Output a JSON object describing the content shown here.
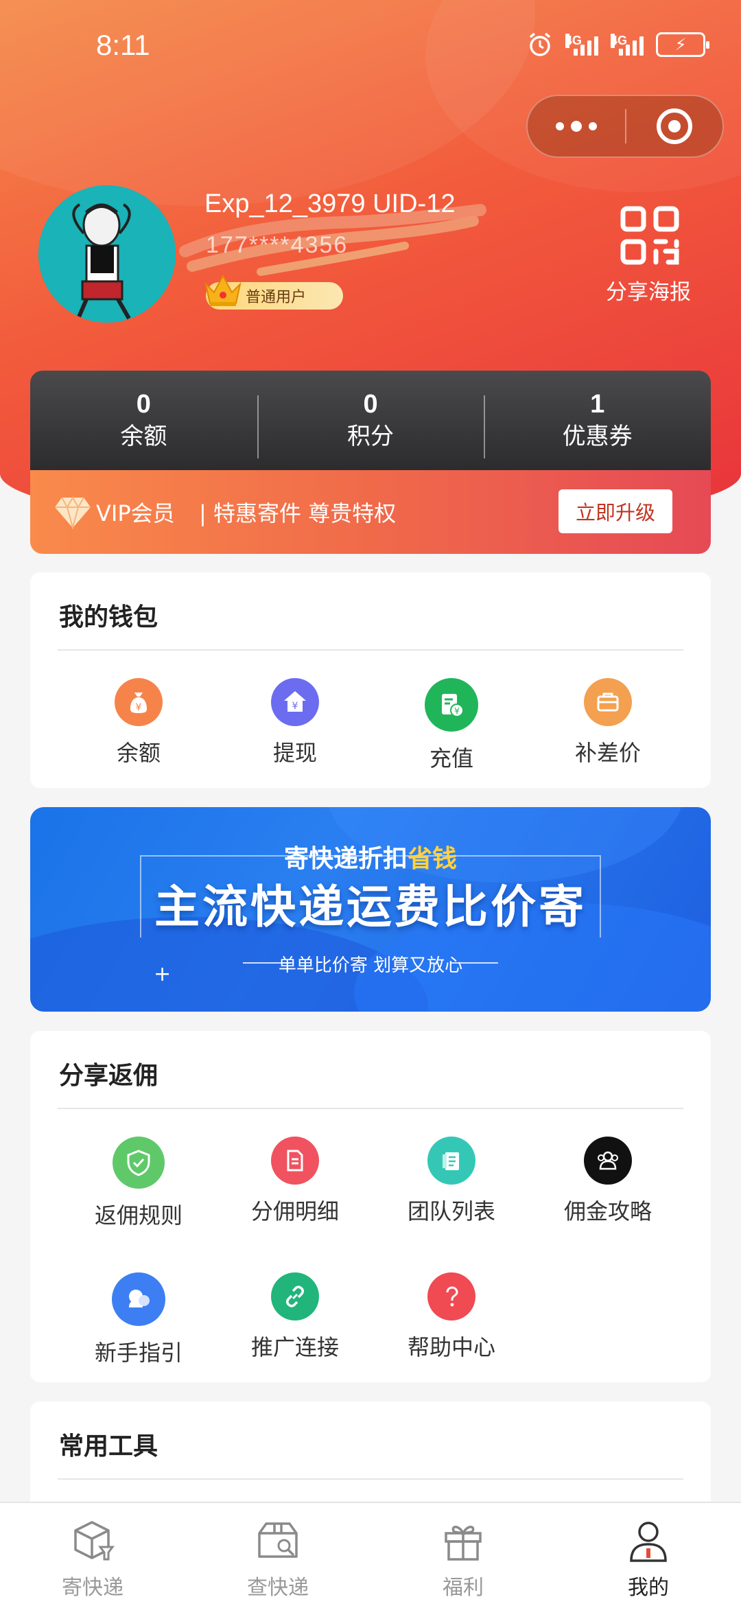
{
  "status_bar": {
    "time": "8:11",
    "network_1": "4G",
    "network_2": "4G"
  },
  "capsule": {
    "more_icon": "more-dots-icon",
    "close_icon": "target-close-icon"
  },
  "profile": {
    "username": "Exp_12_3979 UID-12",
    "phone_masked": "177****4356",
    "member_badge": "普通用户",
    "share_poster_label": "分享海报"
  },
  "stats": [
    {
      "value": "0",
      "label": "余额"
    },
    {
      "value": "0",
      "label": "积分"
    },
    {
      "value": "1",
      "label": "优惠券"
    }
  ],
  "vip": {
    "title": "VIP会员",
    "desc": "| 特惠寄件 尊贵特权",
    "upgrade_label": "立即升级"
  },
  "wallet": {
    "title": "我的钱包",
    "items": [
      {
        "label": "余额",
        "icon": "money-bag-icon",
        "color": "#f6844a"
      },
      {
        "label": "提现",
        "icon": "withdraw-house-icon",
        "color": "#6b6cf0"
      },
      {
        "label": "充值",
        "icon": "recharge-doc-icon",
        "color": "#21b55a"
      },
      {
        "label": "补差价",
        "icon": "briefcase-icon",
        "color": "#f3a050"
      }
    ]
  },
  "banner": {
    "top_text_1": "寄快递折扣",
    "top_text_highlight": "省钱",
    "main_text": "主流快递运费比价寄",
    "sub_text": "单单比价寄 划算又放心"
  },
  "share": {
    "title": "分享返佣",
    "items": [
      {
        "label": "返佣规则",
        "icon": "shield-check-icon",
        "color": "#5fc96a"
      },
      {
        "label": "分佣明细",
        "icon": "document-list-icon",
        "color": "#f0525f"
      },
      {
        "label": "团队列表",
        "icon": "notebook-icon",
        "color": "#35c7b6"
      },
      {
        "label": "佣金攻略",
        "icon": "group-users-icon",
        "color": "#111111"
      },
      {
        "label": "新手指引",
        "icon": "chat-bubbles-icon",
        "color": "#3d7ff2"
      },
      {
        "label": "推广连接",
        "icon": "link-icon",
        "color": "#21b57b"
      },
      {
        "label": "帮助中心",
        "icon": "question-icon",
        "color": "#f04a52"
      }
    ]
  },
  "tools": {
    "title": "常用工具"
  },
  "tabbar": [
    {
      "label": "寄快递",
      "icon": "send-package-icon",
      "active": false
    },
    {
      "label": "查快递",
      "icon": "track-package-icon",
      "active": false
    },
    {
      "label": "福利",
      "icon": "gift-icon",
      "active": false
    },
    {
      "label": "我的",
      "icon": "profile-icon",
      "active": true
    }
  ],
  "colors": {
    "header_start": "#f58a4a",
    "header_end": "#e8333b",
    "stats_bg": "#2c2c2e",
    "upgrade_text": "#c23420",
    "banner_blue": "#1a73e8"
  }
}
